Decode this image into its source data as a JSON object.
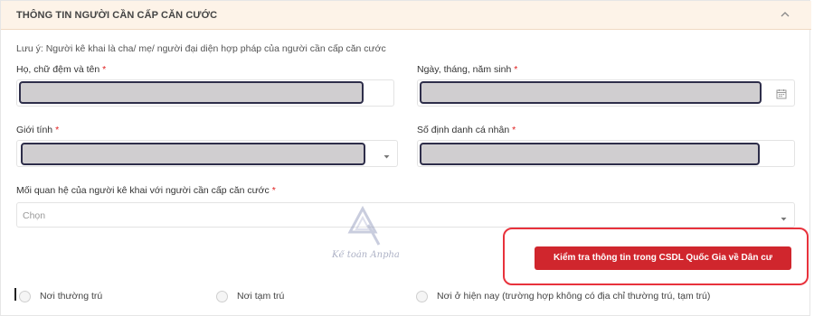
{
  "section": {
    "title": "THÔNG TIN NGƯỜI CẦN CẤP CĂN CƯỚC"
  },
  "note": "Lưu ý: Người kê khai là cha/ mẹ/ người đại diện hợp pháp của người cần cấp căn cước",
  "fields": {
    "full_name": {
      "label": "Họ, chữ đệm và tên",
      "required_mark": "*"
    },
    "dob": {
      "label": "Ngày, tháng, năm sinh",
      "required_mark": "*"
    },
    "gender": {
      "label": "Giới tính",
      "required_mark": "*"
    },
    "personal_id": {
      "label": "Số định danh cá nhân",
      "required_mark": "*"
    },
    "relationship": {
      "label": "Mối quan hệ của người kê khai với người cần cấp căn cước",
      "required_mark": "*",
      "placeholder": "Chọn"
    }
  },
  "watermark": {
    "text": "Kế toán Anpha"
  },
  "check_button": {
    "label": "Kiểm tra thông tin trong CSDL Quốc Gia về Dân cư"
  },
  "address_options": [
    {
      "label": "Nơi thường trú"
    },
    {
      "label": "Nơi tạm trú"
    },
    {
      "label": "Nơi ở hiện nay (trường hợp không có địa chỉ thường trú, tạm trú)"
    }
  ],
  "icons": {
    "collapse": "chevron-up-icon",
    "calendar": "calendar-icon",
    "dropdown": "caret-down-icon",
    "logo": "anpha-logo-icon"
  },
  "colors": {
    "header_bg": "#fdf3e8",
    "button_bg": "#d0262d",
    "highlight_border": "#e8323c",
    "required": "#e02020",
    "masked_field": "#d0ced0"
  }
}
